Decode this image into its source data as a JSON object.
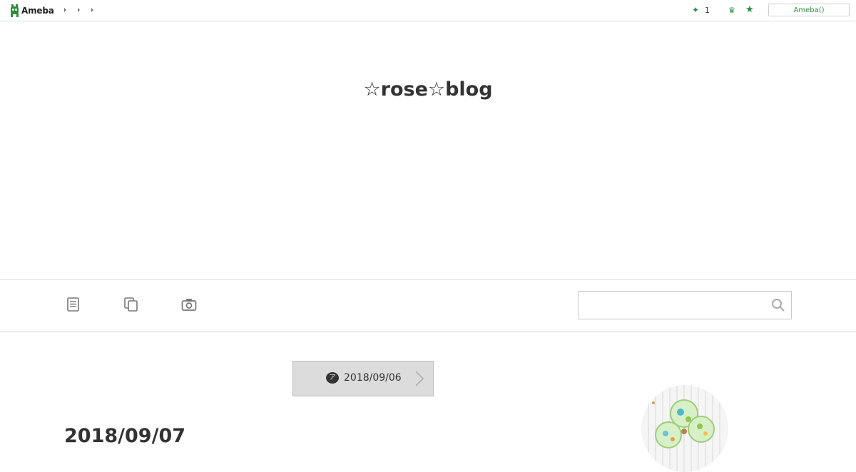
{
  "global_nav": {
    "logo_text": "Ameba",
    "notification_count": "1",
    "login_label": "Ameba()"
  },
  "blog": {
    "title": "☆rose☆blog"
  },
  "search": {
    "placeholder": ""
  },
  "pager": {
    "prev_badge": "ア",
    "prev_date": "2018/09/06"
  },
  "entry": {
    "date": "2018/09/07"
  },
  "colors": {
    "brand_green": "#2d8c3c",
    "pager_bg": "#dcdcdc"
  }
}
